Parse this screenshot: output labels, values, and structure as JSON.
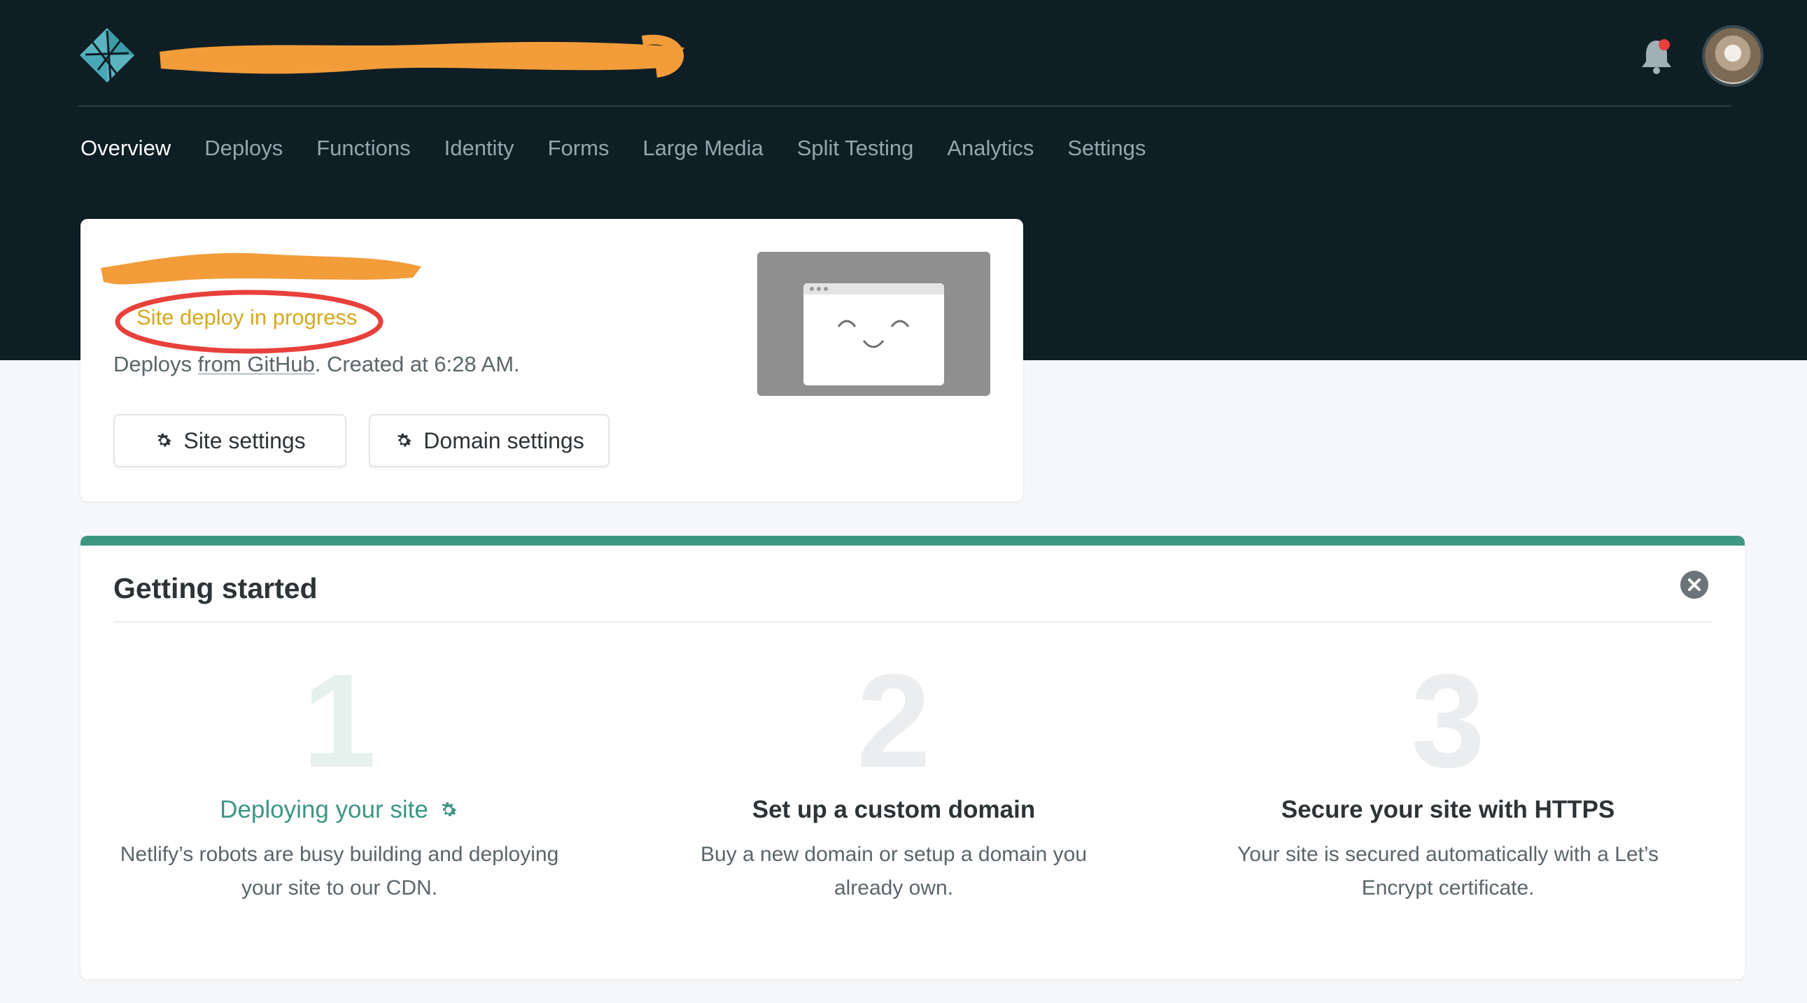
{
  "nav": {
    "items": [
      {
        "label": "Overview",
        "active": true
      },
      {
        "label": "Deploys"
      },
      {
        "label": "Functions"
      },
      {
        "label": "Identity"
      },
      {
        "label": "Forms"
      },
      {
        "label": "Large Media"
      },
      {
        "label": "Split Testing"
      },
      {
        "label": "Analytics"
      },
      {
        "label": "Settings"
      }
    ]
  },
  "site_card": {
    "status": "Site deploy in progress",
    "deploy_prefix": "Deploys ",
    "deploy_source_obscured": "from GitHub",
    "deploy_suffix": ". Created at 6:28 AM.",
    "site_settings_label": "Site settings",
    "domain_settings_label": "Domain settings"
  },
  "getting_started": {
    "title": "Getting started",
    "steps": [
      {
        "number": "1",
        "title": "Deploying your site",
        "description_line1": "Netlify’s robots are busy building and deploying",
        "description_line2": "your site to our CDN."
      },
      {
        "number": "2",
        "title": "Set up a custom domain",
        "description_line1": "Buy a new domain or setup a domain you",
        "description_line2": "already own."
      },
      {
        "number": "3",
        "title": "Secure your site with HTTPS",
        "description_line1": "Your site is secured automatically with a Let’s",
        "description_line2": "Encrypt certificate."
      }
    ]
  },
  "colors": {
    "header_bg": "#0e1e25",
    "accent_teal": "#3d9682",
    "status_yellow": "#d6a81c",
    "annotation_red": "#e8403a",
    "redaction_orange": "#f39c3a"
  },
  "icons": {
    "logo": "netlify-logo-icon",
    "notifications": "bell-icon",
    "settings": "gear-icon",
    "close": "close-circle-icon"
  }
}
